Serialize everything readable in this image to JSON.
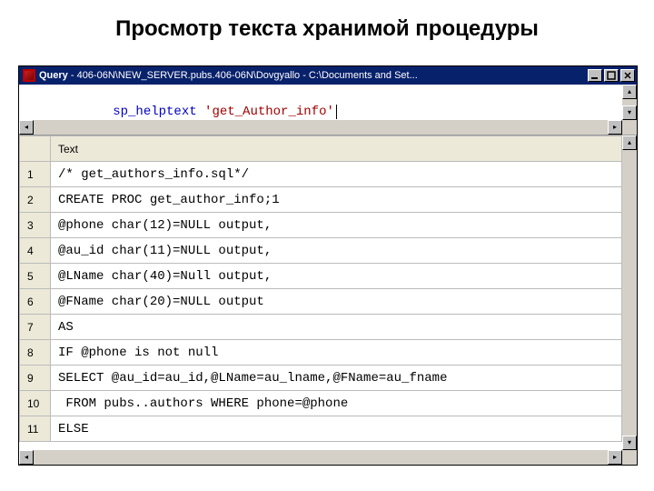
{
  "slide": {
    "title": "Просмотр текста хранимой процедуры"
  },
  "window": {
    "title_prefix": "Query",
    "title_rest": " - 406-06N\\NEW_SERVER.pubs.406-06N\\Dovgyallo - C:\\Documents and Set..."
  },
  "query": {
    "keyword": "sp_helptext",
    "arg": "'get_Author_info'"
  },
  "results": {
    "column_header": "Text",
    "rows": [
      {
        "n": "1",
        "text": "/* get_authors_info.sql*/"
      },
      {
        "n": "2",
        "text": "CREATE PROC get_author_info;1"
      },
      {
        "n": "3",
        "text": "@phone char(12)=NULL output,"
      },
      {
        "n": "4",
        "text": "@au_id char(11)=NULL output,"
      },
      {
        "n": "5",
        "text": "@LName char(40)=Null output,"
      },
      {
        "n": "6",
        "text": "@FName char(20)=NULL output"
      },
      {
        "n": "7",
        "text": "AS"
      },
      {
        "n": "8",
        "text": "IF @phone is not null"
      },
      {
        "n": "9",
        "text": "SELECT @au_id=au_id,@LName=au_lname,@FName=au_fname"
      },
      {
        "n": "10",
        "text": " FROM pubs..authors WHERE phone=@phone"
      },
      {
        "n": "11",
        "text": "ELSE"
      }
    ]
  }
}
